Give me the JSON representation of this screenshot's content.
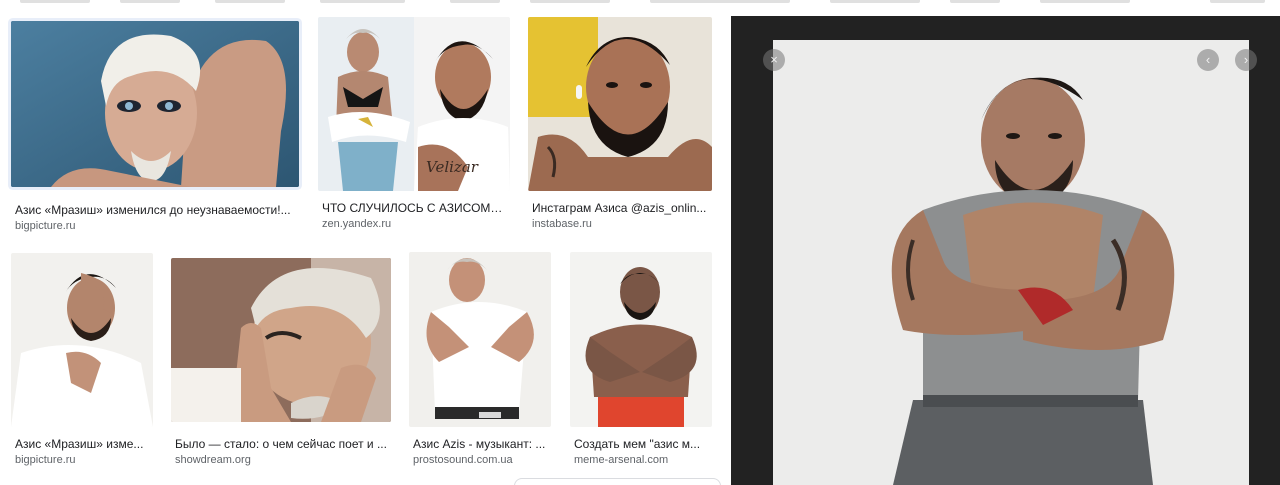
{
  "results": [
    {
      "caption": "Азис «Мразиш» изменился до неузнаваемости!...",
      "source": "bigpicture.ru",
      "thumb_alt": "Азис «Мразиш» изменился до неузнаваемости",
      "selected": true
    },
    {
      "caption": "ЧТО СЛУЧИЛОСЬ С АЗИСОМ? ...",
      "source": "zen.yandex.ru",
      "thumb_alt": "ЧТО СЛУЧИЛОСЬ С АЗИСОМ"
    },
    {
      "caption": "Инстаграм Азиса @azis_onlin...",
      "source": "instabase.ru",
      "thumb_alt": "Инстаграм Азиса"
    },
    {
      "caption": "Азис «Мразиш» изме...",
      "source": "bigpicture.ru",
      "thumb_alt": "Азис «Мразиш»"
    },
    {
      "caption": "Было — стало: о чем сейчас поет и ...",
      "source": "showdream.org",
      "thumb_alt": "Было — стало"
    },
    {
      "caption": "Азис Azis - музыкант: ...",
      "source": "prostosound.com.ua",
      "thumb_alt": "Азис Azis - музыкант"
    },
    {
      "caption": "Создать мем \"азис м...",
      "source": "meme-arsenal.com",
      "thumb_alt": "Создать мем азис"
    }
  ],
  "viewer": {
    "close_icon": "×",
    "prev_icon": "‹",
    "next_icon": "›",
    "image_alt": "Азис"
  },
  "colors": {
    "viewer_bg": "#222222",
    "caption_text": "#202124",
    "source_text": "#5f6368"
  }
}
